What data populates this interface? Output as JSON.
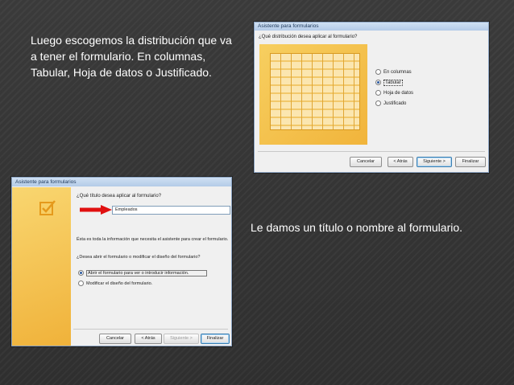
{
  "captions": {
    "layout_text": "Luego escogemos la distribución que va a tener el formulario. En columnas, Tabular, Hoja de datos o Justificado.",
    "title_text": "Le damos un título o nombre al formulario."
  },
  "wizard_layout": {
    "window_title": "Asistente para formularios",
    "question": "¿Qué distribución desea aplicar al formulario?",
    "options": [
      {
        "label": "En columnas",
        "selected": false
      },
      {
        "label": "Tabular",
        "selected": true
      },
      {
        "label": "Hoja de datos",
        "selected": false
      },
      {
        "label": "Justificado",
        "selected": false
      }
    ],
    "buttons": {
      "cancel": "Cancelar",
      "back": "< Atrás",
      "next": "Siguiente >",
      "finish": "Finalizar"
    }
  },
  "wizard_title": {
    "window_title": "Asistente para formularios",
    "question": "¿Qué título desea aplicar al formulario?",
    "title_value": "Empleados",
    "info_text": "Ésta es toda la información que necesita el asistente para crear el formulario.",
    "open_question": "¿Desea abrir el formulario o modificar el diseño del formulario?",
    "options": [
      {
        "label": "Abrir el formulario para ver o introducir información.",
        "selected": true
      },
      {
        "label": "Modificar el diseño del formulario.",
        "selected": false
      }
    ],
    "buttons": {
      "cancel": "Cancelar",
      "back": "< Atrás",
      "next": "Siguiente >",
      "finish": "Finalizar"
    }
  },
  "colors": {
    "accent": "#f5c34a",
    "highlight_arrow": "#e01010"
  }
}
